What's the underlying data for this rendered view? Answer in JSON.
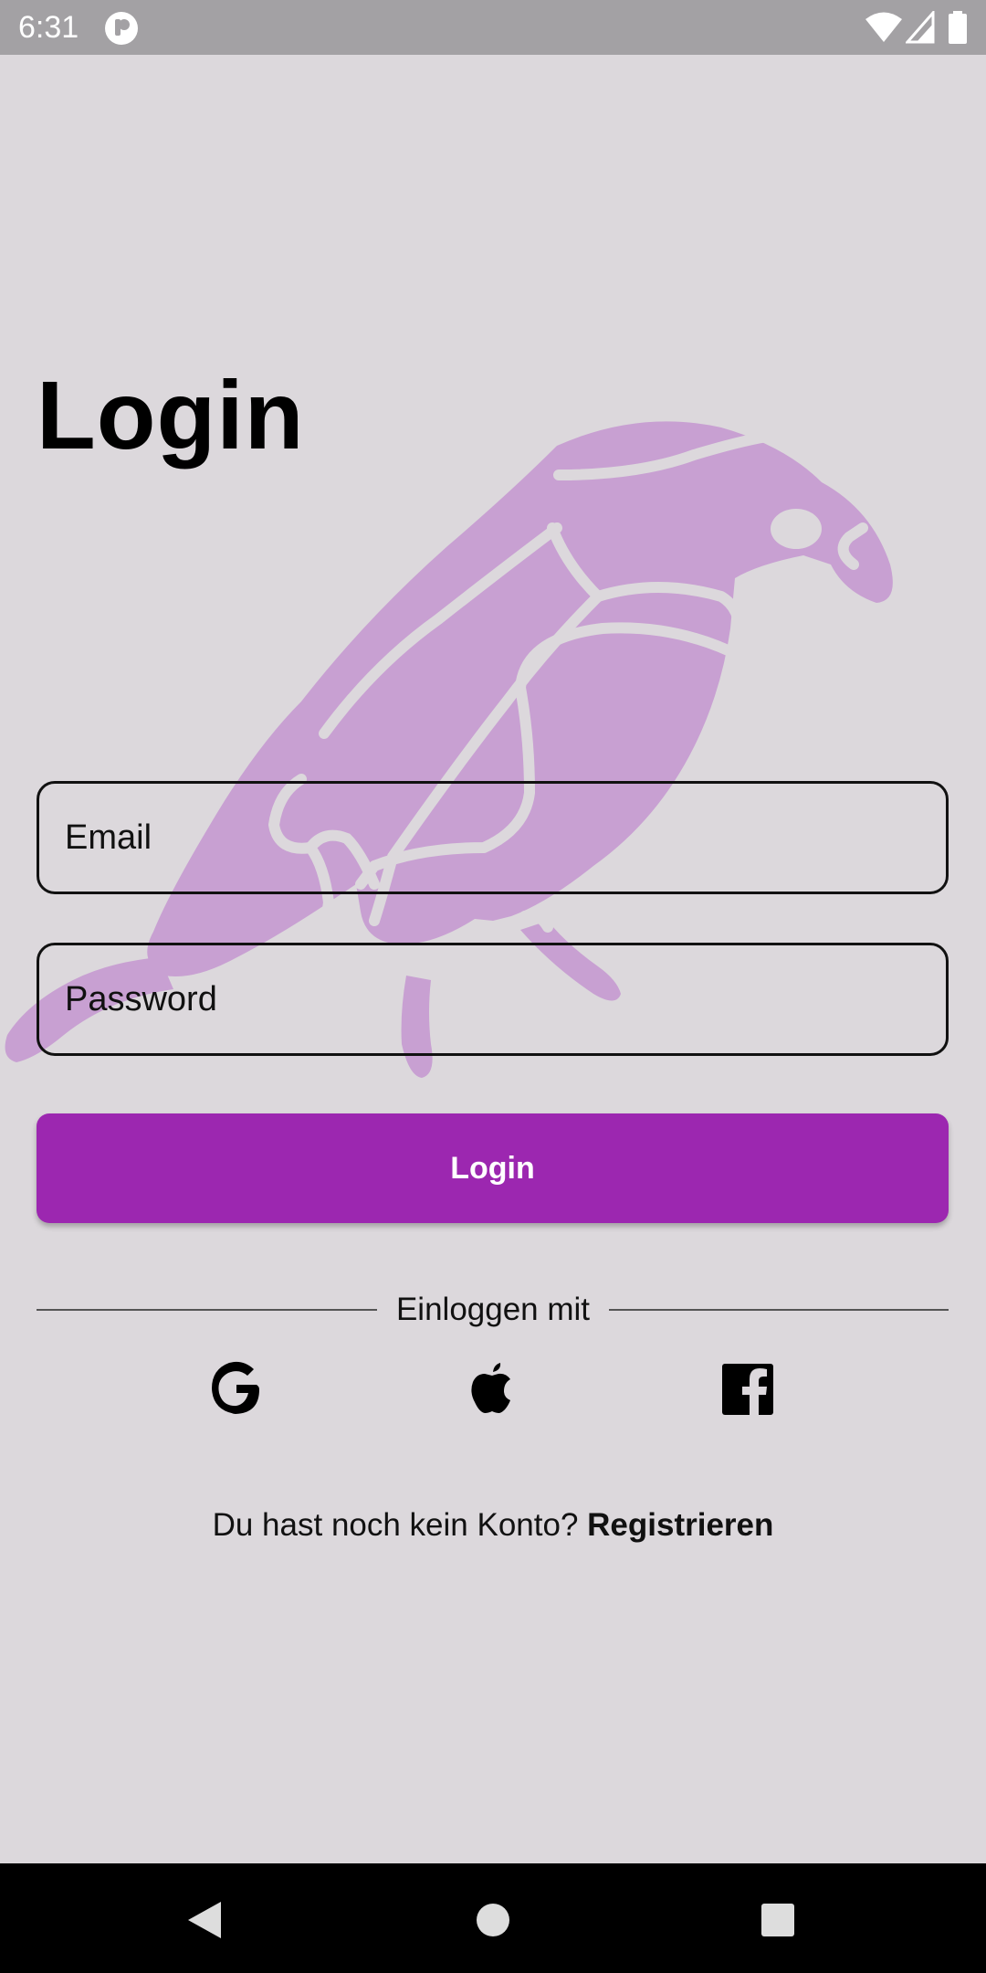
{
  "status_bar": {
    "time": "6:31",
    "icons": [
      "app-icon",
      "wifi-icon",
      "cellular-signal-icon",
      "battery-icon"
    ]
  },
  "login": {
    "title": "Login",
    "email_placeholder": "Email",
    "password_placeholder": "Password",
    "login_button": "Login",
    "divider_text": "Einloggen mit",
    "social": [
      "google-icon",
      "apple-icon",
      "facebook-icon"
    ],
    "signup_prompt": "Du hast noch kein Konto?",
    "signup_link": "Registrieren"
  },
  "colors": {
    "background": "#dcd8dc",
    "accent": "#9c27b0",
    "parrot": "#c8a0d2",
    "status_bar": "#a3a1a4",
    "nav_bar": "#000000"
  },
  "nav_bar": {
    "icons": [
      "back-icon",
      "home-icon",
      "recents-icon"
    ]
  }
}
